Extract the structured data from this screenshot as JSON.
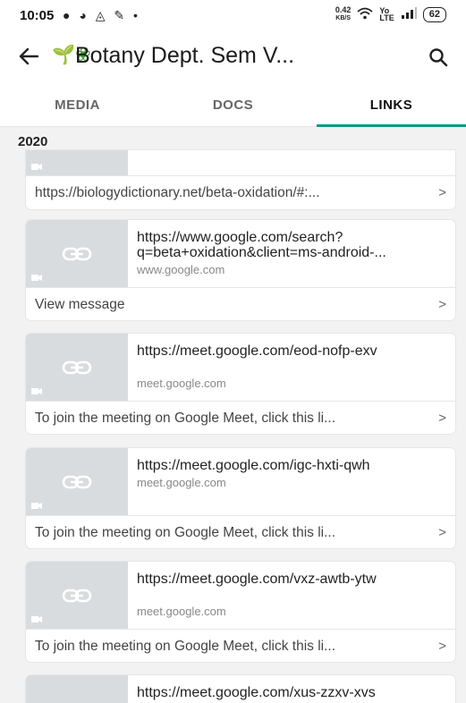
{
  "status": {
    "time": "10:05",
    "left_icons": "● ◕ ◬ ✎ •",
    "net_speed_value": "0.42",
    "net_speed_unit": "KB/S",
    "battery": "62"
  },
  "appbar": {
    "title": "Botany Dept. Sem V...",
    "emoji": "🌱❀"
  },
  "tabs": [
    {
      "label": "MEDIA"
    },
    {
      "label": "DOCS"
    },
    {
      "label": "LINKS"
    }
  ],
  "active_tab": "LINKS",
  "section": {
    "year": "2020"
  },
  "cards": [
    {
      "footer": "https://biologydictionary.net/beta-oxidation/#:...",
      "chevron": ">"
    },
    {
      "url": "https://www.google.com/search?q=beta+oxidation&client=ms-android-...",
      "domain": "www.google.com",
      "footer": "View message",
      "chevron": ">"
    },
    {
      "url": "https://meet.google.com/eod-nofp-exv",
      "domain": "meet.google.com",
      "footer": "To join the meeting on Google Meet, click this li...",
      "chevron": ">"
    },
    {
      "url": "https://meet.google.com/igc-hxti-qwh",
      "domain": "meet.google.com",
      "footer": "To join the meeting on Google Meet, click this li...",
      "chevron": ">"
    },
    {
      "url": "https://meet.google.com/vxz-awtb-ytw",
      "domain": "meet.google.com",
      "footer": "To join the meeting on Google Meet, click this li...",
      "chevron": ">"
    },
    {
      "url": "https://meet.google.com/xus-zzxv-xvs"
    }
  ],
  "colors": {
    "accent": "#0b9a85",
    "thumb_bg": "#d9dcde",
    "page_bg": "#f2f2f2"
  }
}
